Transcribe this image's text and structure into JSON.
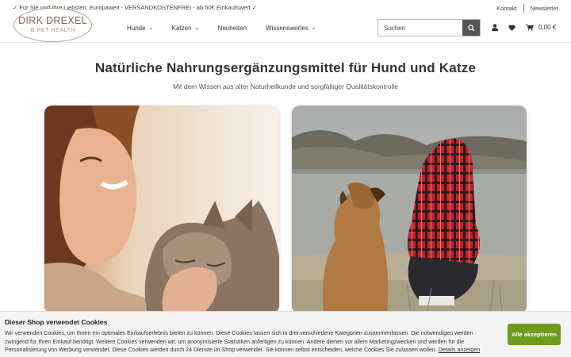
{
  "topbar": {
    "promo_icon": "check-icon",
    "promo_text": "Für Sie und Ihre Liebsten: Europaweit - VERSANDKOSTENFREI - ab 50€ Einkaufswert",
    "links": [
      "Kontakt",
      "Newsletter"
    ]
  },
  "logo": {
    "line1": "DIRK DREXEL",
    "line2": "PET HEALTH"
  },
  "nav": {
    "items": [
      {
        "label": "Hunde",
        "has_dropdown": true
      },
      {
        "label": "Katzen",
        "has_dropdown": true
      },
      {
        "label": "Neuheiten",
        "has_dropdown": false
      },
      {
        "label": "Wissenswertes",
        "has_dropdown": true
      }
    ]
  },
  "search": {
    "placeholder": "Suchen",
    "icon": "search-icon"
  },
  "header_icons": {
    "account": "user-icon",
    "wishlist": "heart-icon",
    "cart": "cart-icon",
    "cart_total": "0,00 €"
  },
  "hero": {
    "title": "Natürliche Nahrungsergänzungsmittel für Hund und Katze",
    "subtitle": "Mit dem Wissen aus alter Naturheilkunde und sorgfältiger Qualitätskontrolle"
  },
  "cards": [
    {
      "image": "woman-with-cat-photo"
    },
    {
      "image": "child-with-dog-by-lake-photo"
    }
  ],
  "cookie_banner": {
    "title": "Dieser Shop verwendet Cookies",
    "text": "Wir verwenden Cookies, um Ihnen ein optimales Einkaufserlebnis bieten zu können. Diese Cookies lassen sich in drei verschiedene Kategorien zusammenfassen. Die notwendigen werden zwingend für Ihren Einkauf benötigt. Weitere Cookies verwenden wir, um anonymisierte Statistiken anfertigen zu können. Andere dienen vor allem Marketingzwecken und werden für die Personalisierung von Werbung verwendet. Diese Cookies werden durch 24 Dienste im Shop verwendet. Sie können selbst entscheiden, welche Cookies Sie zulassen wollen.",
    "details_link": "Details anzeigen",
    "accept_label": "Alle akzeptieren"
  },
  "colors": {
    "accent_green": "#6e9a1e",
    "search_button": "#555555",
    "logo_gold": "#b59b76"
  }
}
